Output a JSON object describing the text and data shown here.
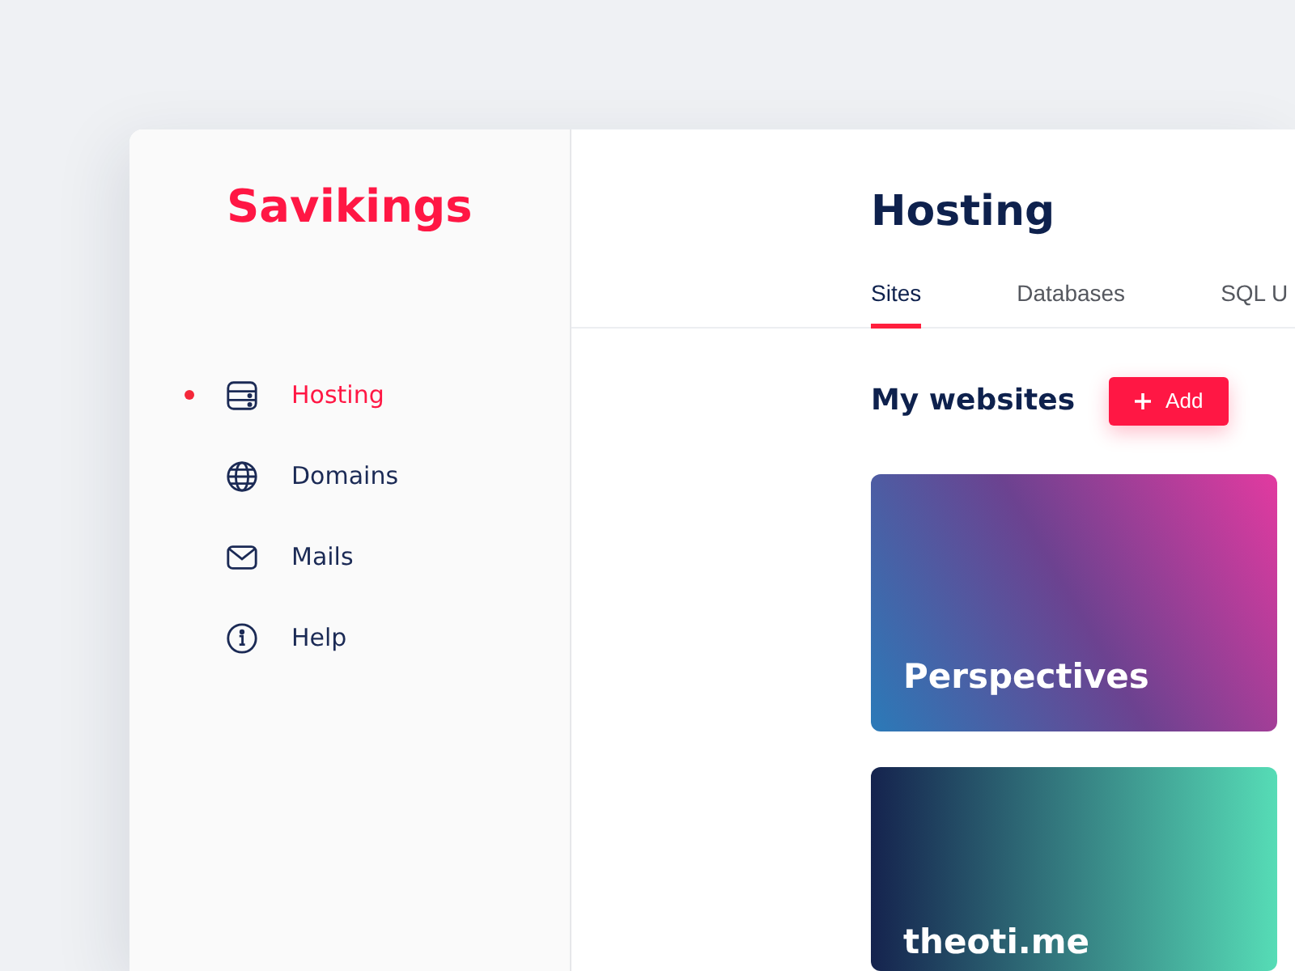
{
  "logo": {
    "text": "Savikings"
  },
  "sidebar": {
    "items": [
      {
        "kind": "server",
        "label": "Hosting",
        "selected": true
      },
      {
        "kind": "globe",
        "label": "Domains",
        "selected": false
      },
      {
        "kind": "mail",
        "label": "Mails",
        "selected": false
      },
      {
        "kind": "info",
        "label": "Help",
        "selected": false
      }
    ]
  },
  "header": {
    "title": "Hosting"
  },
  "tabs": [
    {
      "label": "Sites",
      "selected": true
    },
    {
      "label": "Databases",
      "selected": false
    },
    {
      "label": "SQL U",
      "selected": false
    }
  ],
  "section": {
    "title": "My websites",
    "add_button": {
      "label": "Add"
    }
  },
  "sites": [
    {
      "name": "Perspectives",
      "kind": "diagonal",
      "gradient": [
        {
          "color": "#2b7ab8"
        },
        {
          "color": "#6c4290"
        },
        {
          "color": "#e23aa0"
        }
      ]
    },
    {
      "name": "theoti.me",
      "kind": "horizontal",
      "gradient": [
        {
          "color": "#15234e"
        },
        {
          "color": "#56dcb6"
        }
      ]
    }
  ]
}
